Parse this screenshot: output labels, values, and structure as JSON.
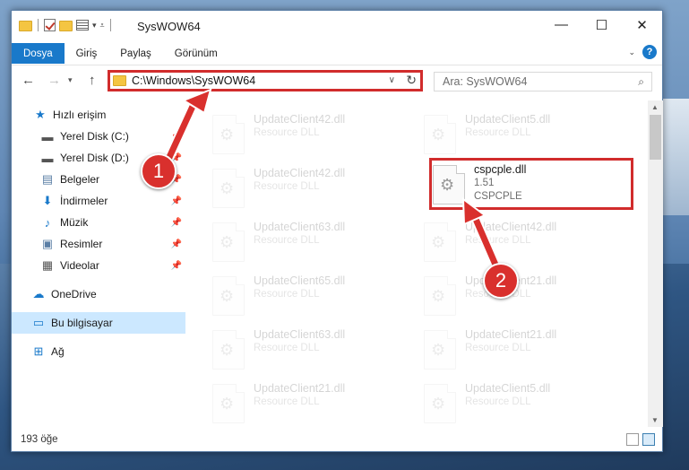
{
  "window": {
    "title": "SysWOW64",
    "controls": {
      "minimize": "—",
      "maximize": "☐",
      "close": "✕"
    }
  },
  "ribbon": {
    "tabs": [
      "Dosya",
      "Giriş",
      "Paylaş",
      "Görünüm"
    ],
    "help": "?"
  },
  "address": {
    "path": "C:\\Windows\\SysWOW64",
    "search_placeholder": "Ara: SysWOW64"
  },
  "sidebar": {
    "items": [
      {
        "label": "Hızlı erişim",
        "icon": "star-icon"
      },
      {
        "label": "Yerel Disk (C:)",
        "icon": "drive-icon"
      },
      {
        "label": "Yerel Disk (D:)",
        "icon": "drive-icon"
      },
      {
        "label": "Belgeler",
        "icon": "documents-icon"
      },
      {
        "label": "İndirmeler",
        "icon": "download-icon"
      },
      {
        "label": "Müzik",
        "icon": "music-icon"
      },
      {
        "label": "Resimler",
        "icon": "pictures-icon"
      },
      {
        "label": "Videolar",
        "icon": "videos-icon"
      },
      {
        "label": "OneDrive",
        "icon": "cloud-icon"
      },
      {
        "label": "Bu bilgisayar",
        "icon": "computer-icon"
      },
      {
        "label": "Ağ",
        "icon": "network-icon"
      }
    ]
  },
  "files": [
    {
      "name": "UpdateClient42.dll",
      "sub": "Resource DLL"
    },
    {
      "name": "UpdateClient5.dll",
      "sub": "Resource DLL"
    },
    {
      "name": "UpdateClient42.dll",
      "sub": "Resource DLL"
    },
    {
      "name": "cspcple.dll",
      "sub": "1.51",
      "desc": "CSPCPLE"
    },
    {
      "name": "UpdateClient63.dll",
      "sub": "Resource DLL"
    },
    {
      "name": "UpdateClient42.dll",
      "sub": "Resource DLL"
    },
    {
      "name": "UpdateClient65.dll",
      "sub": "Resource DLL"
    },
    {
      "name": "UpdateClient21.dll",
      "sub": "Resource DLL"
    },
    {
      "name": "UpdateClient63.dll",
      "sub": "Resource DLL"
    },
    {
      "name": "UpdateClient21.dll",
      "sub": "Resource DLL"
    },
    {
      "name": "UpdateClient21.dll",
      "sub": "Resource DLL"
    },
    {
      "name": "UpdateClient5.dll",
      "sub": "Resource DLL"
    }
  ],
  "status": {
    "count": "193 öğe"
  },
  "annotations": {
    "step1": "1",
    "step2": "2"
  },
  "colors": {
    "accent": "#1979ca",
    "highlight": "#d12c2c",
    "selected": "#cce8ff"
  }
}
